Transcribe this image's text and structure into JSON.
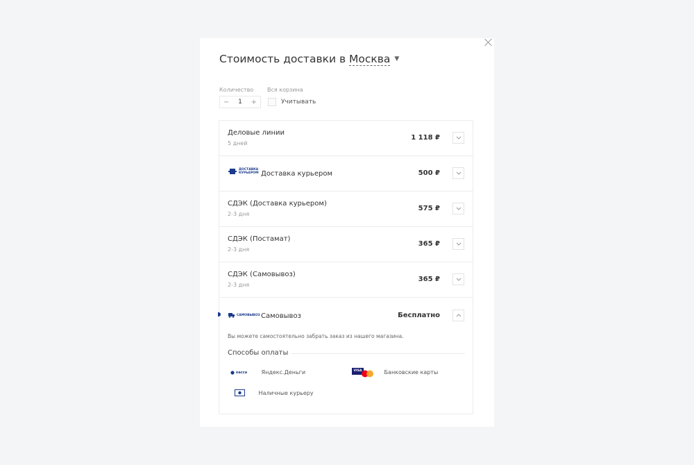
{
  "header": {
    "title_prefix": "Стоимость доставки в",
    "city": "Москва"
  },
  "controls": {
    "quantity_label": "Количество",
    "quantity_value": "1",
    "minus": "−",
    "plus": "+",
    "cart_label": "Вся корзина",
    "cart_checkbox_label": "Учитывать",
    "cart_checked": false
  },
  "options": [
    {
      "name": "Деловые линии",
      "sub": "5 дней",
      "price": "1 118 ₽"
    },
    {
      "name": "Доставка курьером",
      "logo_text": [
        "ДОСТАВКА",
        "КУРЬЕРОМ"
      ],
      "price": "500 ₽"
    },
    {
      "name": "СДЭК (Доставка курьером)",
      "sub": "2-3 дня",
      "price": "575 ₽"
    },
    {
      "name": "СДЭК (Постамат)",
      "sub": "2-3 дня",
      "price": "365 ₽"
    },
    {
      "name": "СДЭК (Самовывоз)",
      "sub": "2-3 дня",
      "price": "365 ₽"
    },
    {
      "name": "Самовывоз",
      "logo_text": "САМОВЫВОЗ",
      "price": "Бесплатно",
      "expanded": true
    }
  ],
  "pickup_details": {
    "description": "Вы можете самостоятельно забрать заказ из нашего магазина.",
    "payment_title": "Способы оплаты",
    "payments": [
      {
        "label": "Яндекс.Деньги",
        "logo_text": "касса",
        "icon": "yoomoney-icon"
      },
      {
        "label": "Банковские карты",
        "logo_text": "VISA",
        "icon": "bank-cards-icon"
      },
      {
        "label": "Наличные курьеру",
        "icon": "cash-icon"
      }
    ]
  },
  "colors": {
    "accent_blue": "#1b3a8c",
    "card_red": "#eb001b",
    "card_orange": "#f79e1b"
  }
}
